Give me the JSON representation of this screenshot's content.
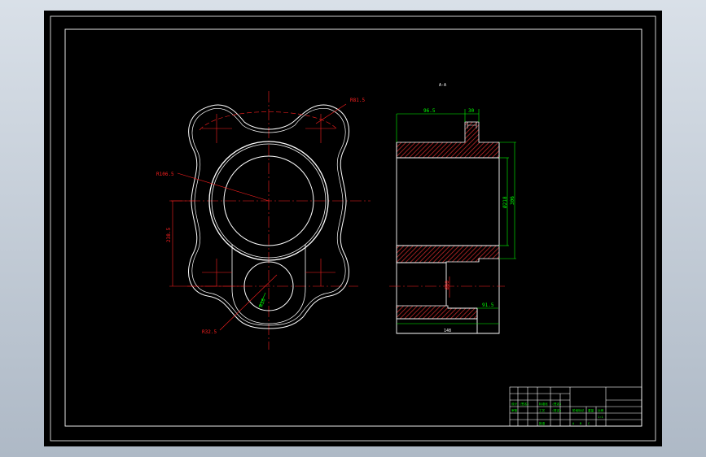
{
  "colors": {
    "paper": "#000000",
    "outline": "#ffffff",
    "center": "#ff2020",
    "dimension": "#00ff00",
    "hatch": "#c02828",
    "desktop": "#c9d2dd"
  },
  "front_view": {
    "labels": {
      "top_right_radius": "R81.5",
      "bore_radius": "R106.5",
      "height_left": "238.5",
      "hole_radius": "R32.5",
      "hole_small": "R16"
    }
  },
  "section_view": {
    "labels": {
      "section_mark": "A-A",
      "top_width": "96.5",
      "top_step": "30",
      "inner_dia": "Ø218",
      "outer_dia": "306",
      "lower_dia": "Ø80",
      "lower_step": "91.5",
      "overall_width": "148"
    }
  },
  "title_block": {
    "row1": [
      "设计",
      "(签名)",
      "标准化",
      "(签名)"
    ],
    "row2": [
      "审核",
      "",
      "工艺",
      "(签名)"
    ],
    "row3": [
      "",
      "",
      "批准",
      ""
    ],
    "stage_header": [
      "阶段标记",
      "重量",
      "比例"
    ],
    "stage_values": [
      "A",
      "B",
      "C",
      "1:1"
    ],
    "sheet": [
      "共",
      "张",
      "第",
      "张"
    ]
  }
}
